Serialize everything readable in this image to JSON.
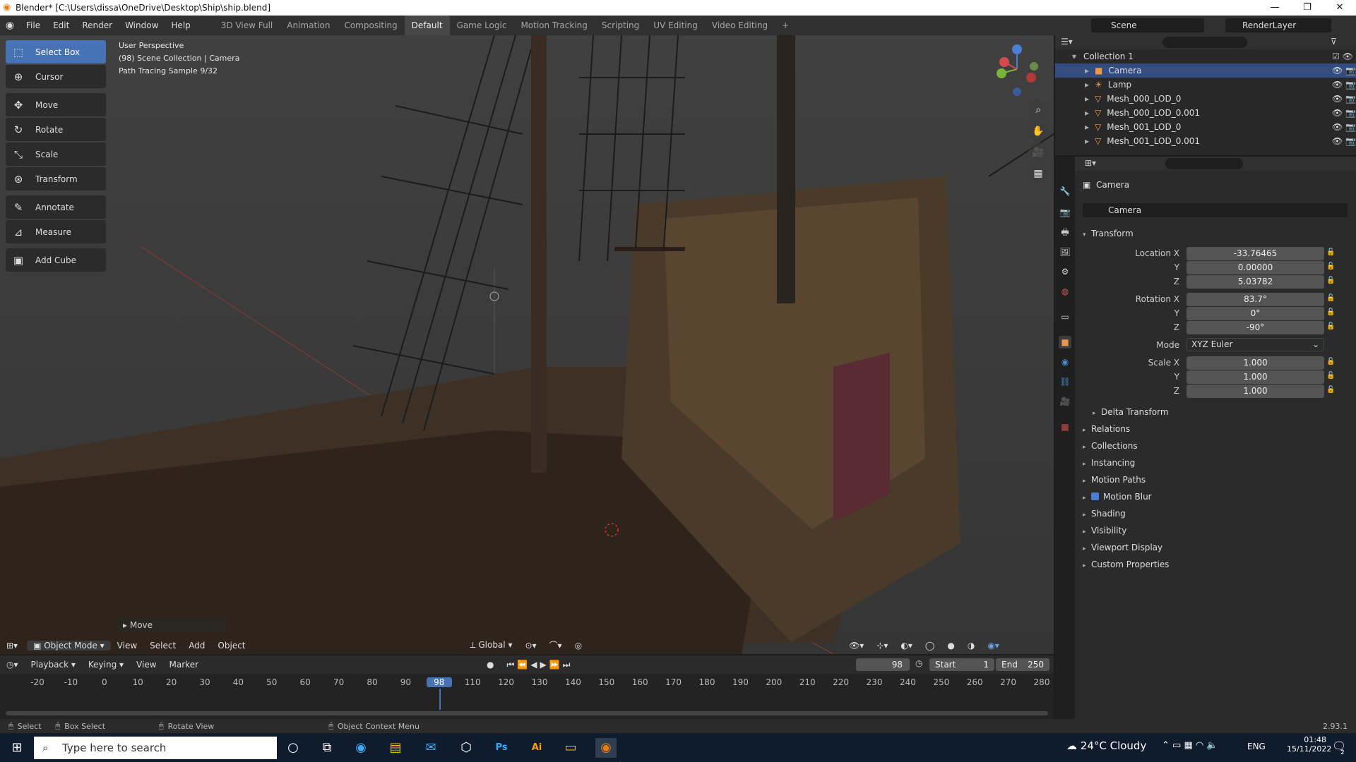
{
  "window": {
    "title": "Blender* [C:\\Users\\dissa\\OneDrive\\Desktop\\Ship\\ship.blend]",
    "min": "—",
    "max": "❐",
    "close": "✕"
  },
  "menus": [
    "File",
    "Edit",
    "Render",
    "Window",
    "Help"
  ],
  "workspaces": [
    "3D View Full",
    "Animation",
    "Compositing",
    "Default",
    "Game Logic",
    "Motion Tracking",
    "Scripting",
    "UV Editing",
    "Video Editing",
    "+"
  ],
  "active_workspace": "Default",
  "scene": "Scene",
  "render_layer": "RenderLayer",
  "tools": [
    {
      "label": "Select Box",
      "icon": "select-box-icon",
      "glyph": "⬚"
    },
    {
      "label": "Cursor",
      "icon": "cursor-icon",
      "glyph": "⊕"
    },
    {
      "label": "Move",
      "icon": "move-icon",
      "glyph": "✥"
    },
    {
      "label": "Rotate",
      "icon": "rotate-icon",
      "glyph": "↻"
    },
    {
      "label": "Scale",
      "icon": "scale-icon",
      "glyph": "⤡"
    },
    {
      "label": "Transform",
      "icon": "transform-icon",
      "glyph": "⊛"
    },
    {
      "label": "Annotate",
      "icon": "annotate-icon",
      "glyph": "✎"
    },
    {
      "label": "Measure",
      "icon": "measure-icon",
      "glyph": "📐"
    },
    {
      "label": "Add Cube",
      "icon": "add-cube-icon",
      "glyph": "▣"
    }
  ],
  "viewport": {
    "info_line1": "User Perspective",
    "info_line2": "(98) Scene Collection | Camera",
    "info_line3": "Path Tracing Sample 9/32",
    "last_op": "Move",
    "mode": "Object Mode",
    "header_menus": [
      "View",
      "Select",
      "Add",
      "Object"
    ],
    "orientation": "Global"
  },
  "outliner": {
    "collection": "Collection 1",
    "items": [
      "Camera",
      "Lamp",
      "Mesh_000_LOD_0",
      "Mesh_000_LOD_0.001",
      "Mesh_001_LOD_0",
      "Mesh_001_LOD_0.001"
    ]
  },
  "properties": {
    "object_name": "Camera",
    "data_name": "Camera",
    "transform_title": "Transform",
    "location": {
      "label": "Location X",
      "x": "-33.76465",
      "y": "0.00000",
      "z": "5.03782"
    },
    "rotation": {
      "label": "Rotation X",
      "x": "83.7°",
      "y": "0°",
      "z": "-90°"
    },
    "mode_label": "Mode",
    "mode_value": "XYZ Euler",
    "scale": {
      "label": "Scale X",
      "x": "1.000",
      "y": "1.000",
      "z": "1.000"
    },
    "axis_y": "Y",
    "axis_z": "Z",
    "delta": "Delta Transform",
    "sections": [
      "Relations",
      "Collections",
      "Instancing",
      "Motion Paths",
      "Motion Blur",
      "Shading",
      "Visibility",
      "Viewport Display",
      "Custom Properties"
    ]
  },
  "timeline": {
    "menus": [
      "Playback",
      "Keying",
      "View",
      "Marker"
    ],
    "current_frame": "98",
    "start_label": "Start",
    "start": "1",
    "end_label": "End",
    "end": "250",
    "ticks": [
      "-20",
      "-10",
      "0",
      "10",
      "20",
      "30",
      "40",
      "50",
      "60",
      "70",
      "80",
      "90",
      "98",
      "110",
      "120",
      "130",
      "140",
      "150",
      "160",
      "170",
      "180",
      "190",
      "200",
      "210",
      "220",
      "230",
      "240",
      "250",
      "260",
      "270",
      "280"
    ],
    "playhead_frame": 98
  },
  "status": {
    "select": "Select",
    "box_select": "Box Select",
    "rotate_view": "Rotate View",
    "context_menu": "Object Context Menu",
    "version": "2.93.1"
  },
  "taskbar": {
    "search_placeholder": "Type here to search",
    "weather": "24°C Cloudy",
    "lang": "ENG",
    "time": "01:48",
    "date": "15/11/2022",
    "notif_count": "2"
  }
}
